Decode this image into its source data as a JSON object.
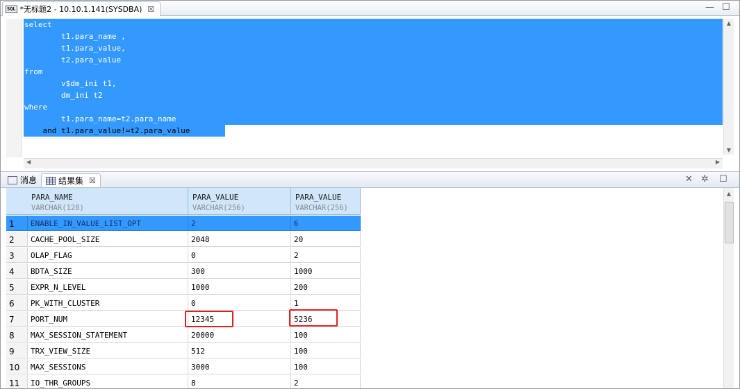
{
  "editor_tab": {
    "icon_text": "SQL",
    "title": "*无标题2 - 10.10.1.141(SYSDBA)",
    "close": "☒"
  },
  "editor": {
    "lines": [
      "select",
      "        t1.para_name ,",
      "        t1.para_value,",
      "        t2.para_value",
      "from",
      "        v$dm_ini t1,",
      "        dm_ini t2",
      "where",
      "        t1.para_name=t2.para_name",
      "    and t1.para_value!=t2.para_value"
    ]
  },
  "result_tabs": [
    {
      "label": "消息",
      "active": false
    },
    {
      "label": "结果集",
      "active": true,
      "close": "☒"
    }
  ],
  "grid": {
    "columns": [
      {
        "name": "PARA_NAME",
        "type": "VARCHAR(128)"
      },
      {
        "name": "PARA_VALUE",
        "type": "VARCHAR(256)"
      },
      {
        "name": "PARA_VALUE",
        "type": "VARCHAR(256)"
      }
    ],
    "rows": [
      {
        "n": "1",
        "c1": "ENABLE_IN_VALUE_LIST_OPT",
        "c2": "2",
        "c3": "6"
      },
      {
        "n": "2",
        "c1": "CACHE_POOL_SIZE",
        "c2": "2048",
        "c3": "20"
      },
      {
        "n": "3",
        "c1": "OLAP_FLAG",
        "c2": "0",
        "c3": "2"
      },
      {
        "n": "4",
        "c1": "BDTA_SIZE",
        "c2": "300",
        "c3": "1000"
      },
      {
        "n": "5",
        "c1": "EXPR_N_LEVEL",
        "c2": "1000",
        "c3": "200"
      },
      {
        "n": "6",
        "c1": "PK_WITH_CLUSTER",
        "c2": "0",
        "c3": "1"
      },
      {
        "n": "7",
        "c1": "PORT_NUM",
        "c2": "12345",
        "c3": "5236"
      },
      {
        "n": "8",
        "c1": "MAX_SESSION_STATEMENT",
        "c2": "20000",
        "c3": "100"
      },
      {
        "n": "9",
        "c1": "TRX_VIEW_SIZE",
        "c2": "512",
        "c3": "100"
      },
      {
        "n": "10",
        "c1": "MAX_SESSIONS",
        "c2": "3000",
        "c3": "100"
      },
      {
        "n": "11",
        "c1": "IO_THR_GROUPS",
        "c2": "8",
        "c3": "2"
      }
    ],
    "selected_row": "1",
    "highlighted_row": "7"
  },
  "colors": {
    "selection": "#3399ff",
    "header": "#cfe6fb",
    "highlight_box": "#e02020"
  }
}
